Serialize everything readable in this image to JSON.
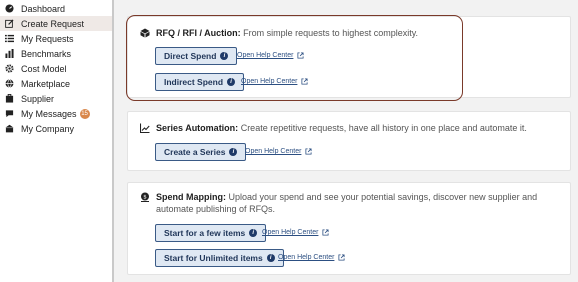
{
  "sidebar": {
    "items": [
      {
        "label": "Dashboard",
        "icon": "dashboard-icon"
      },
      {
        "label": "Create Request",
        "icon": "edit-icon",
        "active": true
      },
      {
        "label": "My Requests",
        "icon": "list-icon"
      },
      {
        "label": "Benchmarks",
        "icon": "bar-chart-icon"
      },
      {
        "label": "Cost Model",
        "icon": "gear-icon"
      },
      {
        "label": "Marketplace",
        "icon": "globe-icon"
      },
      {
        "label": "Supplier",
        "icon": "supplier-icon"
      },
      {
        "label": "My Messages",
        "icon": "chat-icon",
        "badge": "15"
      },
      {
        "label": "My Company",
        "icon": "company-icon"
      }
    ]
  },
  "cards": {
    "rfq": {
      "title": "RFQ / RFI / Auction:",
      "desc": " From simple requests to highest complexity.",
      "buttons": [
        "Direct Spend",
        "Indirect Spend"
      ],
      "help": "Open Help Center"
    },
    "series": {
      "title": "Series Automation:",
      "desc": " Create repetitive requests, have all history in one place and automate it.",
      "buttons": [
        "Create a Series"
      ],
      "help": "Open Help Center"
    },
    "spend": {
      "title": "Spend Mapping:",
      "desc": " Upload your spend and see your potential savings, discover new supplier and automate publishing of RFQs.",
      "buttons": [
        "Start for a few items",
        "Start for Unlimited items"
      ],
      "help": "Open Help Center"
    }
  },
  "colors": {
    "accent": "#1f3a68",
    "highlight_border": "#7a3a2a",
    "badge": "#d9874a",
    "active_nav": "#efe9e6"
  }
}
